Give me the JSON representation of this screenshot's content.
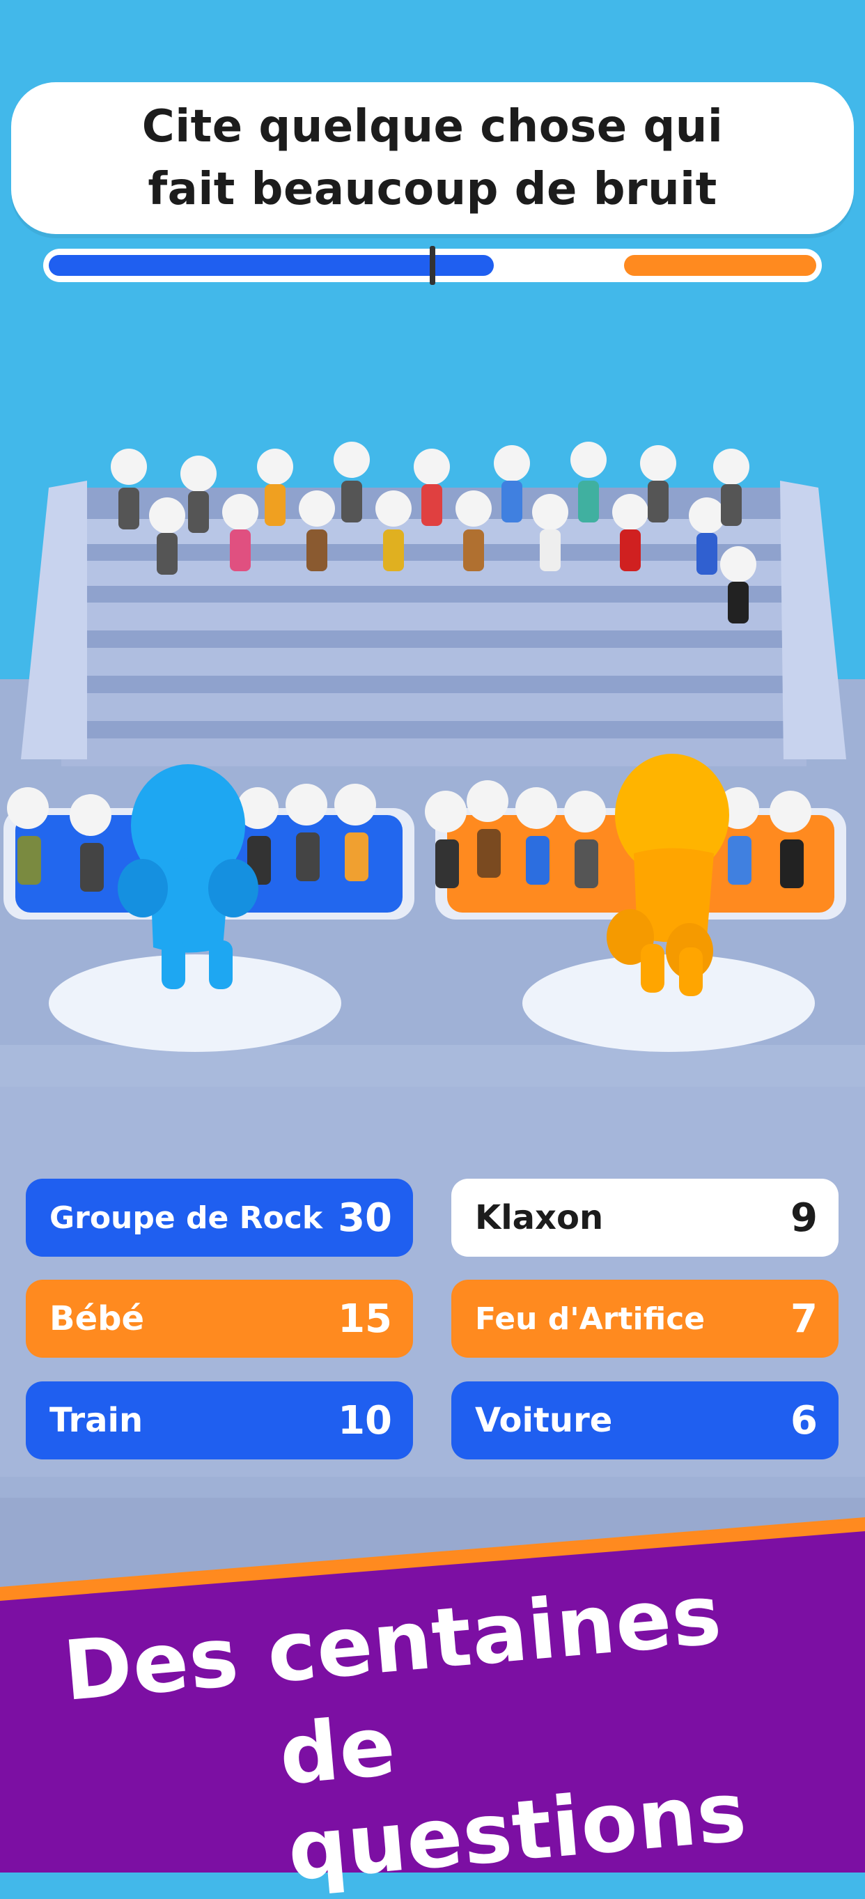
{
  "question": {
    "line1": "Cite quelque chose qui",
    "line2": "fait beaucoup de bruit"
  },
  "progress": {
    "blue_fraction": 0.58,
    "orange_fraction": 0.25,
    "marker_fraction": 0.5,
    "blue_color": "#1f5ff0",
    "orange_color": "#ff8a1f"
  },
  "answers": [
    {
      "label": "Groupe de Rock",
      "score": "30",
      "style": "blue"
    },
    {
      "label": "Klaxon",
      "score": "9",
      "style": "white"
    },
    {
      "label": "Bébé",
      "score": "15",
      "style": "orange"
    },
    {
      "label": "Feu d'Artifice",
      "score": "7",
      "style": "orange"
    },
    {
      "label": "Train",
      "score": "10",
      "style": "blue"
    },
    {
      "label": "Voiture",
      "score": "6",
      "style": "blue"
    }
  ],
  "banner": {
    "line1": "Des centaines",
    "line2": "de questions",
    "background": "#7c0fa3",
    "stripe": "#ff8a1f"
  },
  "colors": {
    "sky": "#42b8ea",
    "blue": "#1f5ff0",
    "orange": "#ff8a1f",
    "white": "#ffffff"
  }
}
